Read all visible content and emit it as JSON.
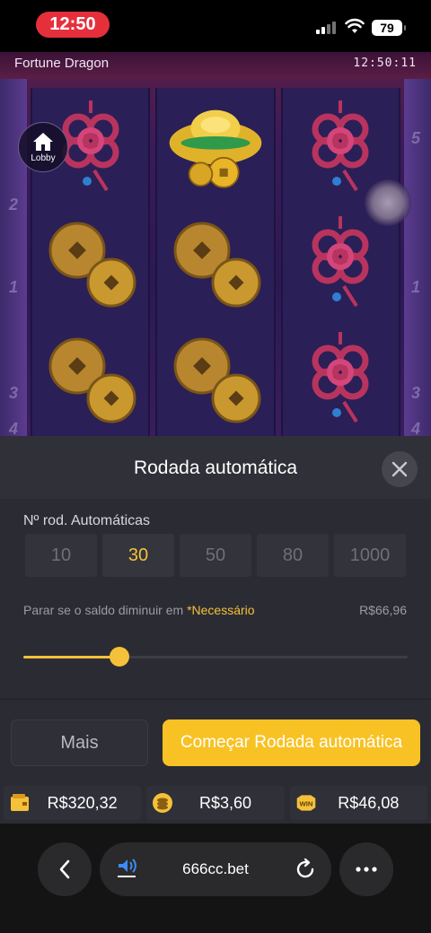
{
  "status_bar": {
    "time": "12:50",
    "battery": "79"
  },
  "game": {
    "title": "Fortune Dragon",
    "clock": "12:50:11",
    "lobby_label": "Lobby",
    "left_rail_numbers": [
      "2",
      "1",
      "3",
      "4"
    ],
    "right_rail_numbers": [
      "5",
      "1",
      "3",
      "4"
    ],
    "reels": [
      [
        "red-knot-icon",
        "gold-coins-icon",
        "gold-coins-icon"
      ],
      [
        "gold-ingot-icon",
        "gold-coins-icon",
        "gold-coins-icon"
      ],
      [
        "red-knot-icon",
        "red-knot-icon",
        "red-knot-icon"
      ]
    ]
  },
  "autoplay": {
    "title": "Rodada automática",
    "count_label": "Nº rod. Automáticas",
    "options": [
      "10",
      "30",
      "50",
      "80",
      "1000"
    ],
    "selected_option": "30",
    "stop_label": "Parar se o saldo diminuir em",
    "stop_required": "*Necessário",
    "stop_value": "R$66,96",
    "slider_level": 0.25,
    "more_label": "Mais",
    "start_label": "Começar Rodada automática"
  },
  "balances": [
    {
      "icon": "wallet-icon",
      "value": "R$320,32"
    },
    {
      "icon": "coins-stack-icon",
      "value": "R$3,60"
    },
    {
      "icon": "win-badge-icon",
      "value": "R$46,08"
    }
  ],
  "browser": {
    "url": "666cc.bet"
  },
  "colors": {
    "accent": "#f8c224",
    "panel": "#2b2c33",
    "status_pill": "#e5303c"
  }
}
